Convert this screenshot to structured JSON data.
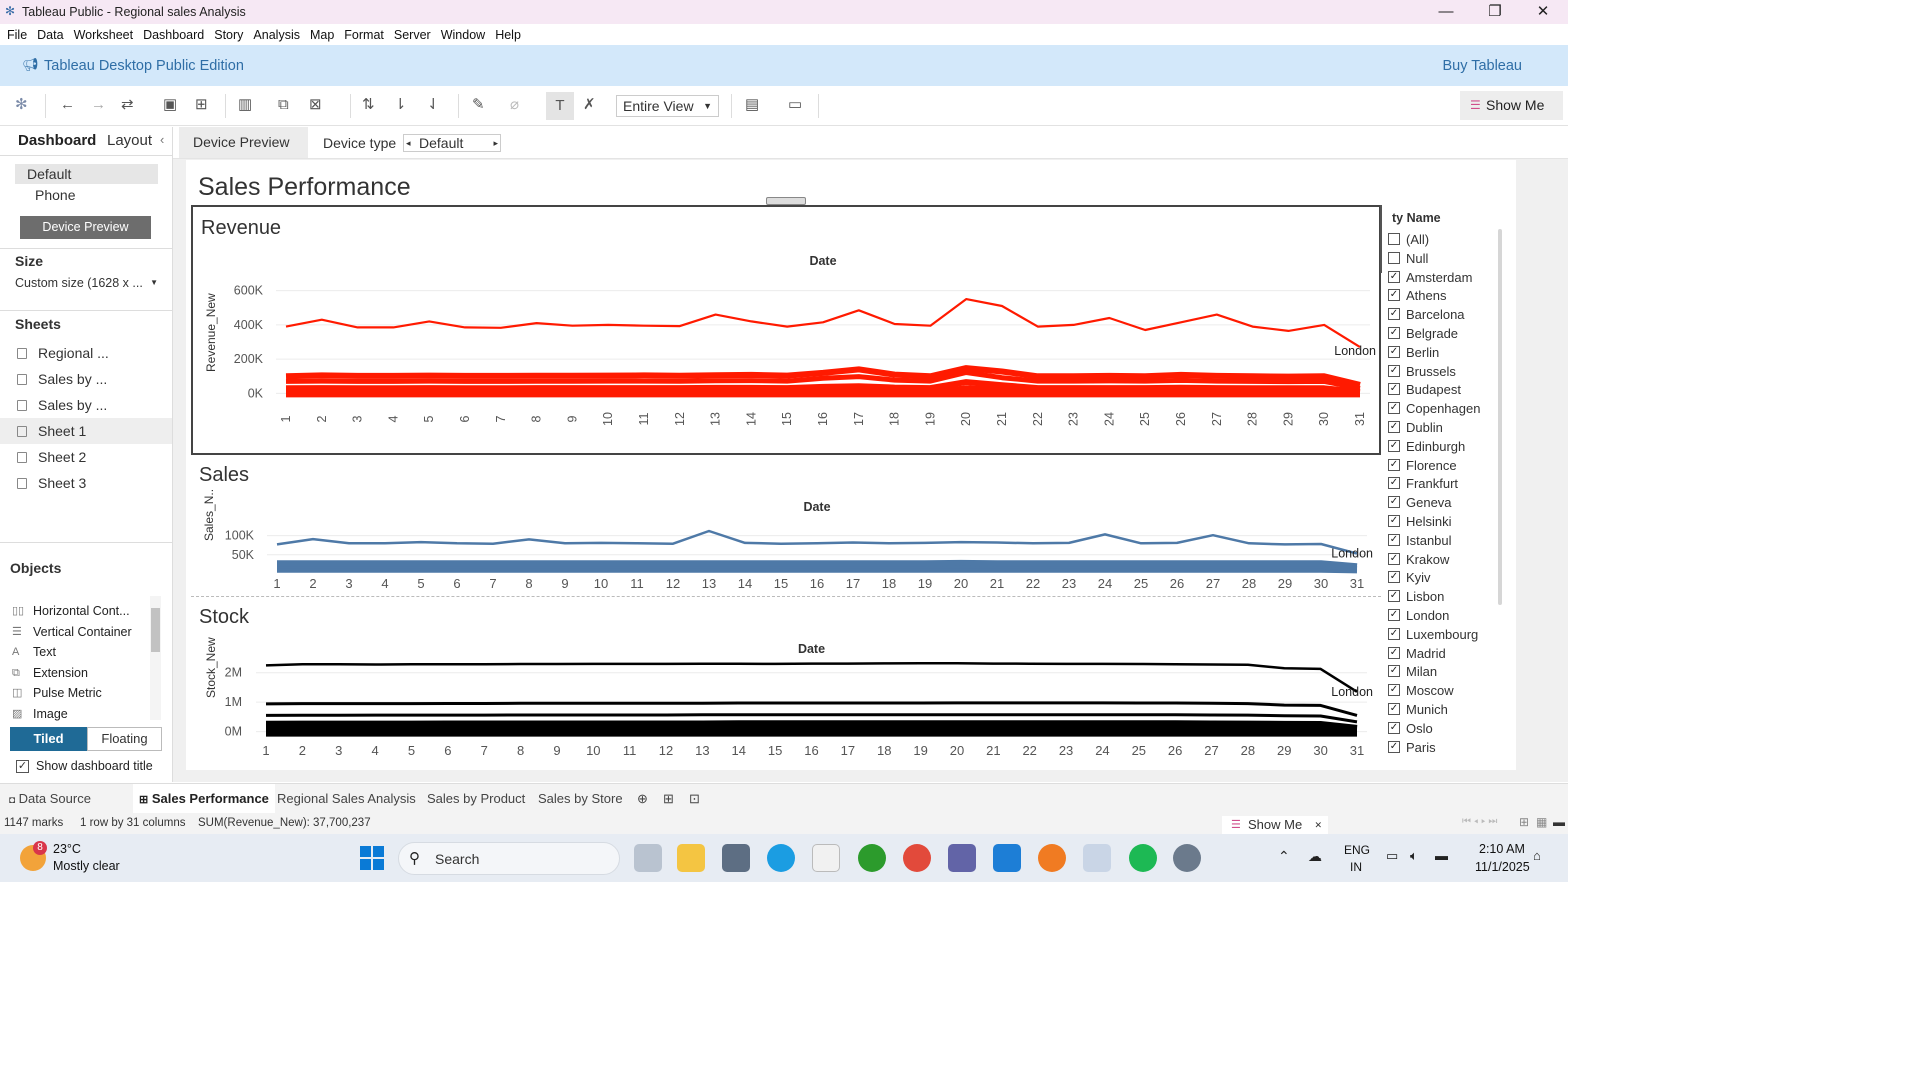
{
  "window": {
    "title": "Tableau Public - Regional sales Analysis",
    "minimize": "—",
    "restore": "❐",
    "close": "✕"
  },
  "menu": [
    "File",
    "Data",
    "Worksheet",
    "Dashboard",
    "Story",
    "Analysis",
    "Map",
    "Format",
    "Server",
    "Window",
    "Help"
  ],
  "banner": {
    "edition": "Tableau Desktop Public Edition",
    "buy": "Buy Tableau"
  },
  "toolbar": {
    "fit": "Entire View",
    "show_me": "Show Me"
  },
  "left_pane": {
    "tabs": [
      "Dashboard",
      "Layout"
    ],
    "devices": [
      "Default",
      "Phone"
    ],
    "device_preview_button": "Device Preview",
    "size_heading": "Size",
    "size_value": "Custom size (1628 x ...",
    "sheets_heading": "Sheets",
    "sheets": [
      "Regional ...",
      "Sales by ...",
      "Sales by ...",
      "Sheet 1",
      "Sheet 2",
      "Sheet 3"
    ],
    "objects_heading": "Objects",
    "objects": [
      "Horizontal Cont...",
      "Vertical Container",
      "Text",
      "Extension",
      "Pulse Metric",
      "Image"
    ],
    "tiled": "Tiled",
    "floating": "Floating",
    "show_title": "Show dashboard title"
  },
  "device_bar": {
    "preview": "Device Preview",
    "type_label": "Device type",
    "type_value": "Default"
  },
  "dashboard": {
    "title": "Sales Performance"
  },
  "chart_data": [
    {
      "type": "line",
      "title": "Revenue",
      "xlabel": "Date",
      "ylabel": "Revenue_New",
      "x": [
        1,
        2,
        3,
        4,
        5,
        6,
        7,
        8,
        9,
        10,
        11,
        12,
        13,
        14,
        15,
        16,
        17,
        18,
        19,
        20,
        21,
        22,
        23,
        24,
        25,
        26,
        27,
        28,
        29,
        30,
        31
      ],
      "yticks": [
        "600K",
        "400K",
        "200K",
        "0K"
      ],
      "ylim": [
        -50000,
        650000
      ],
      "color": "#ff1a00",
      "label": "London",
      "series": [
        {
          "name": "London",
          "values": [
            390000,
            430000,
            385000,
            385000,
            420000,
            385000,
            383000,
            410000,
            395000,
            400000,
            395000,
            393000,
            460000,
            420000,
            390000,
            415000,
            485000,
            405000,
            395000,
            550000,
            510000,
            390000,
            400000,
            440000,
            370000,
            415000,
            460000,
            390000,
            365000,
            400000,
            270000
          ]
        },
        {
          "values": [
            100000,
            105000,
            102000,
            102000,
            104000,
            102000,
            102000,
            103000,
            103000,
            104000,
            105000,
            103000,
            106000,
            108000,
            104000,
            120000,
            140000,
            110000,
            100000,
            148000,
            128000,
            100000,
            100000,
            102000,
            100000,
            108000,
            102000,
            100000,
            98000,
            100000,
            50000
          ]
        },
        {
          "values": [
            70000,
            72000,
            70000,
            70000,
            72000,
            70000,
            70000,
            71000,
            71000,
            72000,
            72000,
            71000,
            74000,
            75000,
            72000,
            88000,
            98000,
            78000,
            72000,
            122000,
            92000,
            72000,
            72000,
            73000,
            72000,
            76000,
            72000,
            70000,
            69000,
            70000,
            30000
          ]
        },
        {
          "values": [
            30000,
            31000,
            30000,
            30000,
            31000,
            30000,
            30000,
            31000,
            31000,
            31000,
            31000,
            31000,
            32000,
            32000,
            31000,
            38000,
            42000,
            34000,
            31000,
            66000,
            48000,
            31000,
            31000,
            31000,
            31000,
            33000,
            31000,
            30000,
            30000,
            30000,
            10000
          ]
        },
        {
          "values": [
            12000,
            12000,
            12000,
            12000,
            12000,
            12000,
            12000,
            12000,
            12000,
            12000,
            12000,
            12000,
            13000,
            13000,
            12000,
            15000,
            17000,
            13000,
            12000,
            32000,
            24000,
            12000,
            12000,
            12000,
            12000,
            13000,
            12000,
            12000,
            12000,
            12000,
            4000
          ]
        },
        {
          "values": [
            0,
            0,
            0,
            0,
            0,
            0,
            0,
            0,
            0,
            0,
            0,
            0,
            0,
            0,
            0,
            0,
            0,
            0,
            0,
            0,
            0,
            0,
            0,
            0,
            0,
            0,
            0,
            0,
            0,
            0,
            0
          ]
        }
      ]
    },
    {
      "type": "line",
      "title": "Sales",
      "xlabel": "Date",
      "ylabel": "Sales_N..",
      "x": [
        1,
        2,
        3,
        4,
        5,
        6,
        7,
        8,
        9,
        10,
        11,
        12,
        13,
        14,
        15,
        16,
        17,
        18,
        19,
        20,
        21,
        22,
        23,
        24,
        25,
        26,
        27,
        28,
        29,
        30,
        31
      ],
      "yticks": [
        "100K",
        "50K"
      ],
      "ylim": [
        0,
        125000
      ],
      "color": "#4e79a7",
      "label": "London",
      "series": [
        {
          "name": "London",
          "values": [
            77000,
            91000,
            80000,
            80000,
            83000,
            80000,
            79000,
            90000,
            80000,
            81000,
            80000,
            79000,
            112000,
            81000,
            79000,
            80000,
            82000,
            80000,
            81000,
            83000,
            82000,
            80000,
            81000,
            103000,
            80000,
            81000,
            101000,
            80000,
            77000,
            78000,
            53000
          ]
        },
        {
          "values": [
            28000,
            28000,
            28000,
            28000,
            28000,
            28000,
            28000,
            28000,
            28000,
            28000,
            28000,
            28000,
            28000,
            28000,
            28000,
            28000,
            28000,
            28000,
            28000,
            29000,
            28000,
            28000,
            28000,
            28000,
            28000,
            28000,
            28000,
            28000,
            28000,
            28000,
            20000
          ]
        },
        {
          "values": [
            20000,
            20000,
            20000,
            20000,
            20000,
            20000,
            20000,
            20000,
            20000,
            20000,
            20000,
            20000,
            20000,
            20000,
            20000,
            20000,
            20000,
            20000,
            20000,
            20000,
            20000,
            20000,
            20000,
            20000,
            20000,
            20000,
            20000,
            20000,
            20000,
            20000,
            14000
          ]
        },
        {
          "values": [
            10000,
            10000,
            10000,
            10000,
            10000,
            10000,
            10000,
            10000,
            10000,
            10000,
            10000,
            10000,
            10000,
            10000,
            10000,
            10000,
            10000,
            10000,
            10000,
            10000,
            10000,
            10000,
            10000,
            10000,
            10000,
            10000,
            10000,
            10000,
            10000,
            10000,
            8000
          ]
        }
      ]
    },
    {
      "type": "line",
      "title": "Stock",
      "xlabel": "Date",
      "ylabel": "Stock_New",
      "x": [
        1,
        2,
        3,
        4,
        5,
        6,
        7,
        8,
        9,
        10,
        11,
        12,
        13,
        14,
        15,
        16,
        17,
        18,
        19,
        20,
        21,
        22,
        23,
        24,
        25,
        26,
        27,
        28,
        29,
        30,
        31
      ],
      "yticks": [
        "2M",
        "1M",
        "0M"
      ],
      "ylim": [
        -150000,
        2500000
      ],
      "color": "#000000",
      "label": "London",
      "series": [
        {
          "name": "London",
          "values": [
            2250000,
            2290000,
            2285000,
            2280000,
            2285000,
            2290000,
            2290000,
            2295000,
            2295000,
            2300000,
            2300000,
            2300000,
            2305000,
            2305000,
            2300000,
            2310000,
            2310000,
            2315000,
            2320000,
            2320000,
            2310000,
            2305000,
            2300000,
            2300000,
            2295000,
            2290000,
            2280000,
            2270000,
            2150000,
            2130000,
            1350000
          ]
        },
        {
          "values": [
            940000,
            950000,
            950000,
            950000,
            950000,
            955000,
            955000,
            960000,
            960000,
            965000,
            965000,
            965000,
            965000,
            970000,
            970000,
            970000,
            970000,
            970000,
            970000,
            975000,
            975000,
            975000,
            975000,
            975000,
            970000,
            970000,
            960000,
            950000,
            900000,
            890000,
            550000
          ]
        },
        {
          "values": [
            550000,
            555000,
            555000,
            560000,
            560000,
            560000,
            560000,
            565000,
            565000,
            565000,
            565000,
            565000,
            570000,
            570000,
            570000,
            570000,
            570000,
            570000,
            570000,
            575000,
            575000,
            575000,
            575000,
            575000,
            570000,
            570000,
            565000,
            560000,
            540000,
            530000,
            330000
          ]
        },
        {
          "values": [
            300000,
            305000,
            305000,
            305000,
            305000,
            310000,
            310000,
            310000,
            310000,
            310000,
            310000,
            310000,
            310000,
            315000,
            315000,
            315000,
            315000,
            315000,
            315000,
            320000,
            320000,
            320000,
            320000,
            320000,
            315000,
            315000,
            310000,
            305000,
            295000,
            290000,
            160000
          ]
        },
        {
          "values": [
            150000,
            150000,
            150000,
            150000,
            150000,
            150000,
            150000,
            150000,
            150000,
            150000,
            150000,
            150000,
            150000,
            150000,
            150000,
            150000,
            150000,
            150000,
            150000,
            150000,
            150000,
            150000,
            150000,
            150000,
            150000,
            150000,
            150000,
            150000,
            145000,
            145000,
            80000
          ]
        },
        {
          "values": [
            0,
            0,
            0,
            0,
            0,
            0,
            0,
            0,
            0,
            0,
            0,
            0,
            0,
            0,
            0,
            0,
            0,
            0,
            0,
            0,
            0,
            0,
            0,
            0,
            0,
            0,
            0,
            0,
            0,
            0,
            0
          ]
        }
      ]
    }
  ],
  "filter": {
    "title": "ty Name",
    "items": [
      {
        "label": "(All)",
        "checked": false
      },
      {
        "label": "Null",
        "checked": false
      },
      {
        "label": "Amsterdam",
        "checked": true
      },
      {
        "label": "Athens",
        "checked": true
      },
      {
        "label": "Barcelona",
        "checked": true
      },
      {
        "label": "Belgrade",
        "checked": true
      },
      {
        "label": "Berlin",
        "checked": true
      },
      {
        "label": "Brussels",
        "checked": true
      },
      {
        "label": "Budapest",
        "checked": true
      },
      {
        "label": "Copenhagen",
        "checked": true
      },
      {
        "label": "Dublin",
        "checked": true
      },
      {
        "label": "Edinburgh",
        "checked": true
      },
      {
        "label": "Florence",
        "checked": true
      },
      {
        "label": "Frankfurt",
        "checked": true
      },
      {
        "label": "Geneva",
        "checked": true
      },
      {
        "label": "Helsinki",
        "checked": true
      },
      {
        "label": "Istanbul",
        "checked": true
      },
      {
        "label": "Krakow",
        "checked": true
      },
      {
        "label": "Kyiv",
        "checked": true
      },
      {
        "label": "Lisbon",
        "checked": true
      },
      {
        "label": "London",
        "checked": true
      },
      {
        "label": "Luxembourg",
        "checked": true
      },
      {
        "label": "Madrid",
        "checked": true
      },
      {
        "label": "Milan",
        "checked": true
      },
      {
        "label": "Moscow",
        "checked": true
      },
      {
        "label": "Munich",
        "checked": true
      },
      {
        "label": "Oslo",
        "checked": true
      },
      {
        "label": "Paris",
        "checked": true
      }
    ]
  },
  "sheet_tabs": [
    "Data Source",
    "Sales Performance",
    "Regional Sales Analysis",
    "Sales by Product",
    "Sales by Store"
  ],
  "status": {
    "marks": "1147 marks",
    "dims": "1 row by 31 columns",
    "sum": "SUM(Revenue_New): 37,700,237",
    "show_me": "Show Me"
  },
  "taskbar": {
    "weather_temp": "23°C",
    "weather_desc": "Mostly clear",
    "weather_badge": "8",
    "search": "Search",
    "lang1": "ENG",
    "lang2": "IN",
    "time": "2:10 AM",
    "date": "11/1/2025"
  }
}
